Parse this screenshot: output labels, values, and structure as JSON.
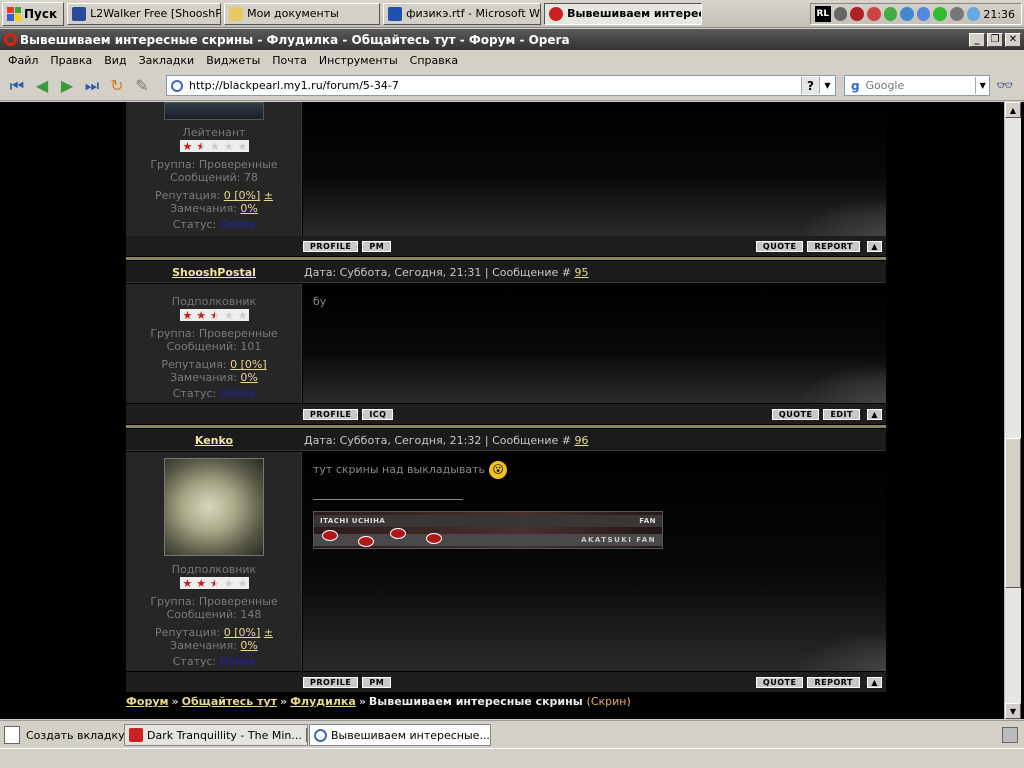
{
  "taskbar": {
    "start_label": "Пуск",
    "tasks": [
      {
        "label": "L2Walker Free [ShooshP...",
        "icon_color": "#2a4a9a"
      },
      {
        "label": "Мои документы",
        "icon_color": "#e8c860"
      },
      {
        "label": "физикэ.rtf - Microsoft W...",
        "icon_color": "#2050b0"
      },
      {
        "label": "Вывешиваем интересне...",
        "icon_color": "#cc2020"
      }
    ],
    "lang": "RL",
    "clock": "21:36"
  },
  "window": {
    "title": "Вывешиваем интересные скрины - Флудилка - Общайтесь тут - Форум - Opera"
  },
  "menu": [
    "Файл",
    "Правка",
    "Вид",
    "Закладки",
    "Виджеты",
    "Почта",
    "Инструменты",
    "Справка"
  ],
  "toolbar": {
    "address": "http://blackpearl.my1.ru/forum/5-34-7",
    "search_placeholder": "Google"
  },
  "posts": [
    {
      "rank": "Лейтенант",
      "stars": 1.5,
      "group": "Группа: Проверенные",
      "messages": "Сообщений: 78",
      "rep_label": "Репутация:",
      "rep_value": "0 [0%]",
      "rep_extra": "±",
      "warn_label": "Замечания:",
      "warn_value": "0%",
      "status_label": "Статус:",
      "status_value": "Online",
      "buttons_left": [
        "PROFILE",
        "PM"
      ],
      "buttons_right": [
        "QUOTE",
        "REPORT"
      ]
    },
    {
      "author": "ShooshPostal",
      "date": "Дата: Суббота, Сегодня, 21:31 | Сообщение #",
      "number": "95",
      "text": "бу",
      "rank": "Подполковник",
      "stars": 2.5,
      "group": "Группа: Проверенные",
      "messages": "Сообщений: 101",
      "rep_label": "Репутация:",
      "rep_value": "0 [0%]",
      "warn_label": "Замечания:",
      "warn_value": "0%",
      "status_label": "Статус:",
      "status_value": "Online",
      "buttons_left": [
        "PROFILE",
        "ICQ"
      ],
      "buttons_right": [
        "QUOTE",
        "EDIT"
      ]
    },
    {
      "author": "Kenko",
      "date": "Дата: Суббота, Сегодня, 21:32 | Сообщение #",
      "number": "96",
      "text": "тут скрины над выкладывать",
      "rank": "Подполковник",
      "stars": 2.5,
      "group": "Группа: Проверенные",
      "messages": "Сообщений: 148",
      "rep_label": "Репутация:",
      "rep_value": "0 [0%]",
      "rep_extra": "±",
      "warn_label": "Замечания:",
      "warn_value": "0%",
      "status_label": "Статус:",
      "status_value": "Online",
      "signature": {
        "line1_left": "ITACHI UCHIHA",
        "line1_right": "FAN",
        "line2": "AKATSUKI FAN"
      },
      "buttons_left": [
        "PROFILE",
        "PM"
      ],
      "buttons_right": [
        "QUOTE",
        "REPORT"
      ]
    }
  ],
  "breadcrumb": {
    "items": [
      "Форум",
      "Общайтесь тут",
      "Флудилка"
    ],
    "current": "Вывешиваем интересные скрины",
    "suffix": "(Скрин)"
  },
  "tabs": {
    "new_tab": "Создать вкладку",
    "items": [
      "Dark Tranquillity - The Min...",
      "Вывешиваем интересные..."
    ]
  },
  "colors": {
    "accent": "#e8d890",
    "star_on": "#c81818",
    "online": "#1f22b4",
    "separator": "#8c8454"
  }
}
